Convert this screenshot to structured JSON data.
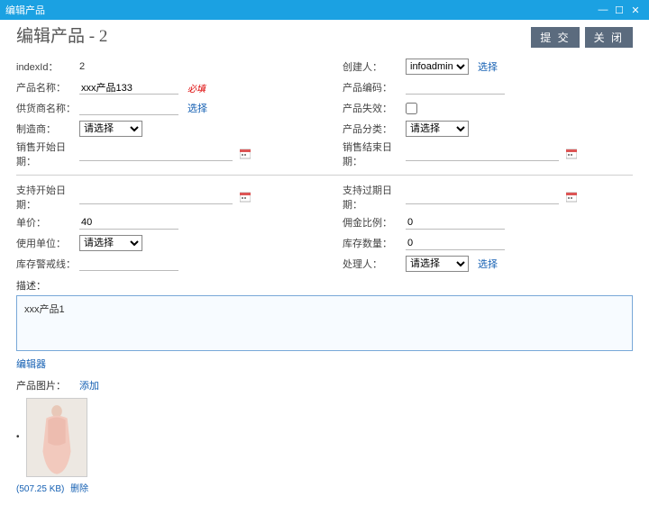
{
  "window": {
    "title": "编辑产品"
  },
  "header": {
    "title": "编辑产品 - 2",
    "submit": "提 交",
    "close": "关 闭"
  },
  "left": {
    "indexId": {
      "label": "indexId：",
      "value": "2"
    },
    "productName": {
      "label": "产品名称：",
      "value": "xxx产品133",
      "required": "必填"
    },
    "supplierName": {
      "label": "供货商名称：",
      "pick": "选择"
    },
    "manufacturer": {
      "label": "制造商：",
      "placeholder": "请选择"
    },
    "saleStart": {
      "label": "销售开始日期："
    },
    "supportStart": {
      "label": "支持开始日期："
    },
    "unitPrice": {
      "label": "单价：",
      "value": "40"
    },
    "usageUnit": {
      "label": "使用单位：",
      "placeholder": "请选择"
    },
    "stockWarn": {
      "label": "库存警戒线："
    }
  },
  "right": {
    "creator": {
      "label": "创建人：",
      "value": "infoadmin",
      "pick": "选择"
    },
    "productCode": {
      "label": "产品编码："
    },
    "invalid": {
      "label": "产品失效："
    },
    "category": {
      "label": "产品分类：",
      "placeholder": "请选择"
    },
    "saleEnd": {
      "label": "销售结束日期："
    },
    "supportEnd": {
      "label": "支持过期日期："
    },
    "commission": {
      "label": "佣金比例：",
      "value": "0"
    },
    "stockQty": {
      "label": "库存数量：",
      "value": "0"
    },
    "handler": {
      "label": "处理人：",
      "placeholder": "请选择",
      "pick": "选择"
    }
  },
  "desc": {
    "label": "描述：",
    "text": "xxx产品1",
    "editor": "编辑器"
  },
  "image": {
    "label": "产品图片：",
    "add": "添加",
    "size": "(507.25 KB)",
    "delete": "删除"
  }
}
